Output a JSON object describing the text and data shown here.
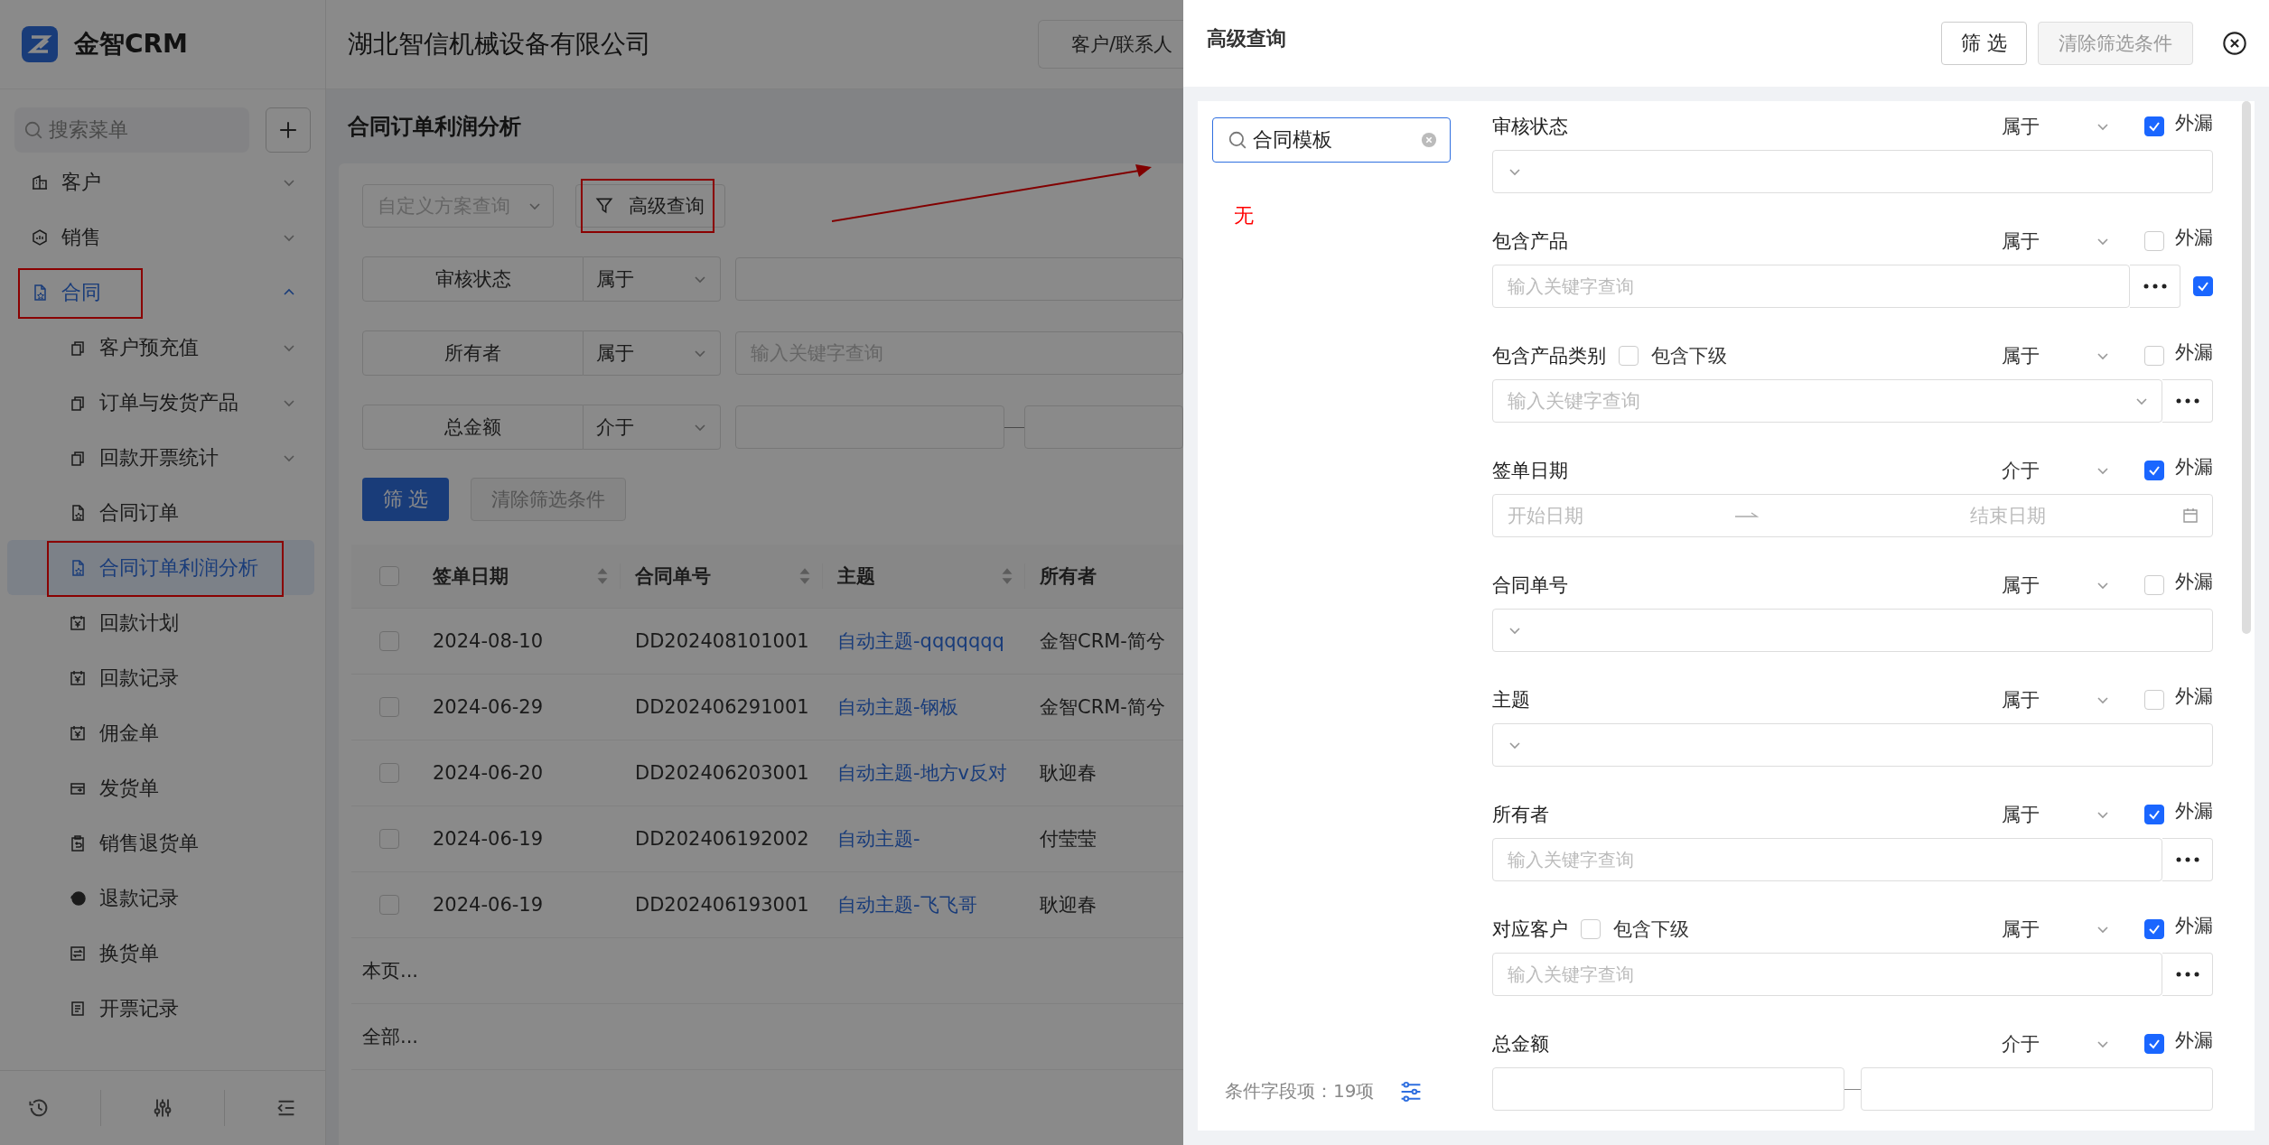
{
  "app": {
    "logo_text": "金智CRM",
    "menu_search_placeholder": "搜索菜单"
  },
  "sidebar": {
    "items": [
      {
        "label": "客户",
        "kind": "customer",
        "expanded": false,
        "selected": false,
        "highlighted": false
      },
      {
        "label": "销售",
        "kind": "sales",
        "expanded": false,
        "selected": false,
        "highlighted": false
      },
      {
        "label": "合同",
        "kind": "contract",
        "expanded": true,
        "selected": false,
        "highlighted": true,
        "children": [
          {
            "label": "客户预充值",
            "kind": "folder",
            "expanded": false,
            "selected": false,
            "highlighted": false
          },
          {
            "label": "订单与发货产品",
            "kind": "folder",
            "expanded": false,
            "selected": false,
            "highlighted": false
          },
          {
            "label": "回款开票统计",
            "kind": "folder",
            "expanded": false,
            "selected": false,
            "highlighted": false
          },
          {
            "label": "合同订单",
            "kind": "contract",
            "selected": false,
            "highlighted": false
          },
          {
            "label": "合同订单利润分析",
            "kind": "contract",
            "selected": true,
            "highlighted": true
          },
          {
            "label": "回款计划",
            "kind": "payment",
            "selected": false,
            "highlighted": false
          },
          {
            "label": "回款记录",
            "kind": "payment",
            "selected": false,
            "highlighted": false
          },
          {
            "label": "佣金单",
            "kind": "payment",
            "selected": false,
            "highlighted": false
          },
          {
            "label": "发货单",
            "kind": "shipping",
            "selected": false,
            "highlighted": false
          },
          {
            "label": "销售退货单",
            "kind": "return",
            "selected": false,
            "highlighted": false
          },
          {
            "label": "退款记录",
            "kind": "refund",
            "selected": false,
            "highlighted": false
          },
          {
            "label": "换货单",
            "kind": "exchange",
            "selected": false,
            "highlighted": false
          },
          {
            "label": "开票记录",
            "kind": "invoice",
            "selected": false,
            "highlighted": false
          }
        ]
      }
    ]
  },
  "header": {
    "company": "湖北智信机械设备有限公司",
    "scope_select": "客户/联系人"
  },
  "page": {
    "title": "合同订单利润分析",
    "scheme_select_placeholder": "自定义方案查询",
    "advanced_button": {
      "label": "高级查询",
      "highlighted": true
    },
    "filters": [
      {
        "field": "审核状态",
        "operator": "属于",
        "kind": "select"
      },
      {
        "field": "所有者",
        "operator": "属于",
        "kind": "text",
        "placeholder": "输入关键字查询"
      },
      {
        "field": "总金额",
        "operator": "介于",
        "kind": "range"
      }
    ],
    "filter_button": "筛 选",
    "clear_button": "清除筛选条件"
  },
  "table": {
    "select_all_checked": false,
    "columns": [
      {
        "label": "签单日期",
        "sortable": true
      },
      {
        "label": "合同单号",
        "sortable": true
      },
      {
        "label": "主题",
        "sortable": true
      },
      {
        "label": "所有者"
      }
    ],
    "rows": [
      {
        "checked": false,
        "cells": [
          "2024-08-10",
          "DD202408101001",
          "自动主题-qqqqqqq",
          "金智CRM-简兮"
        ]
      },
      {
        "checked": false,
        "cells": [
          "2024-06-29",
          "DD202406291001",
          "自动主题-钢板",
          "金智CRM-简兮"
        ]
      },
      {
        "checked": false,
        "cells": [
          "2024-06-20",
          "DD202406203001",
          "自动主题-地方v反对",
          "耿迎春"
        ]
      },
      {
        "checked": false,
        "cells": [
          "2024-06-19",
          "DD202406192002",
          "自动主题-",
          "付莹莹"
        ]
      },
      {
        "checked": false,
        "cells": [
          "2024-06-19",
          "DD202406193001",
          "自动主题-飞飞哥",
          "耿迎春"
        ]
      }
    ],
    "summary_rows": [
      "本页...",
      "全部..."
    ]
  },
  "drawer": {
    "title": "高级查询",
    "filter_button": "筛 选",
    "clear_button": "清除筛选条件",
    "template_search": {
      "value": "合同模板"
    },
    "template_empty": "无",
    "field_count": "条件字段项：19项",
    "fields": [
      {
        "label": "审核状态",
        "kind": "select",
        "operator": "属于",
        "outside_label": "外漏",
        "outside_checked": true
      },
      {
        "label": "包含产品",
        "kind": "lookup",
        "placeholder": "输入关键字查询",
        "extra_checked": true,
        "operator": "属于",
        "outside_label": "外漏",
        "outside_checked": false
      },
      {
        "label": "包含产品类别",
        "kind": "lookup_select",
        "placeholder": "输入关键字查询",
        "include_sub": {
          "label": "包含下级",
          "checked": false
        },
        "operator": "属于",
        "outside_label": "外漏",
        "outside_checked": false
      },
      {
        "label": "签单日期",
        "kind": "daterange",
        "start_placeholder": "开始日期",
        "end_placeholder": "结束日期",
        "operator": "介于",
        "outside_label": "外漏",
        "outside_checked": true
      },
      {
        "label": "合同单号",
        "kind": "select",
        "operator": "属于",
        "outside_label": "外漏",
        "outside_checked": false
      },
      {
        "label": "主题",
        "kind": "select",
        "operator": "属于",
        "outside_label": "外漏",
        "outside_checked": false
      },
      {
        "label": "所有者",
        "kind": "lookup",
        "placeholder": "输入关键字查询",
        "operator": "属于",
        "outside_label": "外漏",
        "outside_checked": true
      },
      {
        "label": "对应客户",
        "kind": "lookup",
        "placeholder": "输入关键字查询",
        "include_sub": {
          "label": "包含下级",
          "checked": false
        },
        "operator": "属于",
        "outside_label": "外漏",
        "outside_checked": true
      },
      {
        "label": "总金额",
        "kind": "range",
        "operator": "介于",
        "outside_label": "外漏",
        "outside_checked": true
      }
    ]
  }
}
